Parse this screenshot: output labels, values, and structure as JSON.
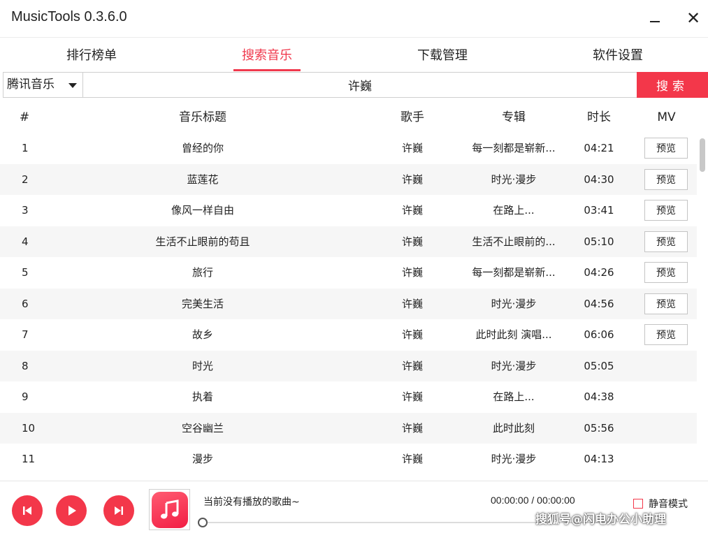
{
  "window": {
    "title": "MusicTools 0.3.6.0",
    "minimize_glyph": "—",
    "close_glyph": "✕"
  },
  "tabs": [
    {
      "label": "排行榜单",
      "active": false
    },
    {
      "label": "搜索音乐",
      "active": true
    },
    {
      "label": "下载管理",
      "active": false
    },
    {
      "label": "软件设置",
      "active": false
    }
  ],
  "search": {
    "source_selected": "腾讯音乐",
    "query": "许巍",
    "button_label": "搜索"
  },
  "table": {
    "headers": {
      "num": "#",
      "title": "音乐标题",
      "artist": "歌手",
      "album": "专辑",
      "duration": "时长",
      "mv": "MV"
    },
    "mv_button_label": "预览",
    "rows": [
      {
        "num": "1",
        "title": "曾经的你",
        "artist": "许巍",
        "album": "每一刻都是崭新...",
        "duration": "04:21",
        "mv": true
      },
      {
        "num": "2",
        "title": "蓝莲花",
        "artist": "许巍",
        "album": "时光·漫步",
        "duration": "04:30",
        "mv": true
      },
      {
        "num": "3",
        "title": "像风一样自由",
        "artist": "许巍",
        "album": "在路上...",
        "duration": "03:41",
        "mv": true
      },
      {
        "num": "4",
        "title": "生活不止眼前的苟且",
        "artist": "许巍",
        "album": "生活不止眼前的...",
        "duration": "05:10",
        "mv": true
      },
      {
        "num": "5",
        "title": "旅行",
        "artist": "许巍",
        "album": "每一刻都是崭新...",
        "duration": "04:26",
        "mv": true
      },
      {
        "num": "6",
        "title": "完美生活",
        "artist": "许巍",
        "album": "时光·漫步",
        "duration": "04:56",
        "mv": true
      },
      {
        "num": "7",
        "title": "故乡",
        "artist": "许巍",
        "album": "此时此刻  演唱...",
        "duration": "06:06",
        "mv": true
      },
      {
        "num": "8",
        "title": "时光",
        "artist": "许巍",
        "album": "时光·漫步",
        "duration": "05:05",
        "mv": false
      },
      {
        "num": "9",
        "title": "执着",
        "artist": "许巍",
        "album": "在路上...",
        "duration": "04:38",
        "mv": false
      },
      {
        "num": "10",
        "title": "空谷幽兰",
        "artist": "许巍",
        "album": "此时此刻",
        "duration": "05:56",
        "mv": false
      },
      {
        "num": "11",
        "title": "漫步",
        "artist": "许巍",
        "album": "时光·漫步",
        "duration": "04:13",
        "mv": false
      }
    ]
  },
  "player": {
    "now_playing": "当前没有播放的歌曲~",
    "time": "00:00:00 / 00:00:00",
    "progress": 0,
    "mute_label": "静音模式",
    "mute_checked": false,
    "accent_color": "#f3374a"
  },
  "watermark": "搜狐号@闪电办公小助理"
}
